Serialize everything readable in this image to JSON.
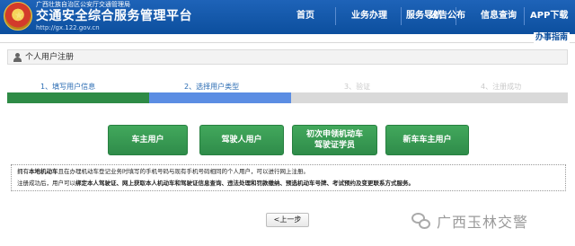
{
  "header": {
    "org": "广西壮族自治区公安厅交通管理局",
    "title": "交通安全综合服务管理平台",
    "url": "http://gx.122.gov.cn",
    "nav": [
      {
        "label": "首页"
      },
      {
        "label": "业务办理"
      },
      {
        "label": "服务导航"
      },
      {
        "label": "公告公布"
      },
      {
        "label": "信息查询"
      },
      {
        "label": "APP下载"
      }
    ],
    "sub_link": "办事指南"
  },
  "section": {
    "title": "个人用户注册"
  },
  "steps": [
    {
      "label": "1、填写用户信息",
      "state": "done"
    },
    {
      "label": "2、选择用户类型",
      "state": "current"
    },
    {
      "label": "3、验证",
      "state": "pending"
    },
    {
      "label": "4、注册成功",
      "state": "pending"
    }
  ],
  "colors": {
    "header_blue": "#1e63b8",
    "step_done": "#2e8b46",
    "step_current": "#5b8de3",
    "step_pending": "#d9d9d9",
    "button_green": "#3a9c55"
  },
  "user_types": [
    {
      "line1": "车主用户",
      "line2": ""
    },
    {
      "line1": "驾驶人用户",
      "line2": ""
    },
    {
      "line1": "初次申领机动车",
      "line2": "驾驶证学员"
    },
    {
      "line1": "新车车主用户",
      "line2": ""
    }
  ],
  "info": {
    "line1_pre": "拥有",
    "line1_bold": "本地机动车",
    "line1_post": "且在办理机动车登记业务时填写的手机号码与现有手机号码相同的个人用户，可以进行网上注册。",
    "line2_pre": "注册成功后，用户可以",
    "line2_bold": "绑定本人驾驶证、网上获取本人机动车和驾驶证信息查询、违法处理和罚款缴纳、预选机动车号牌、考试预约及变更联系方式服务。"
  },
  "back_button": "<上一步",
  "watermark": "广西玉林交警"
}
